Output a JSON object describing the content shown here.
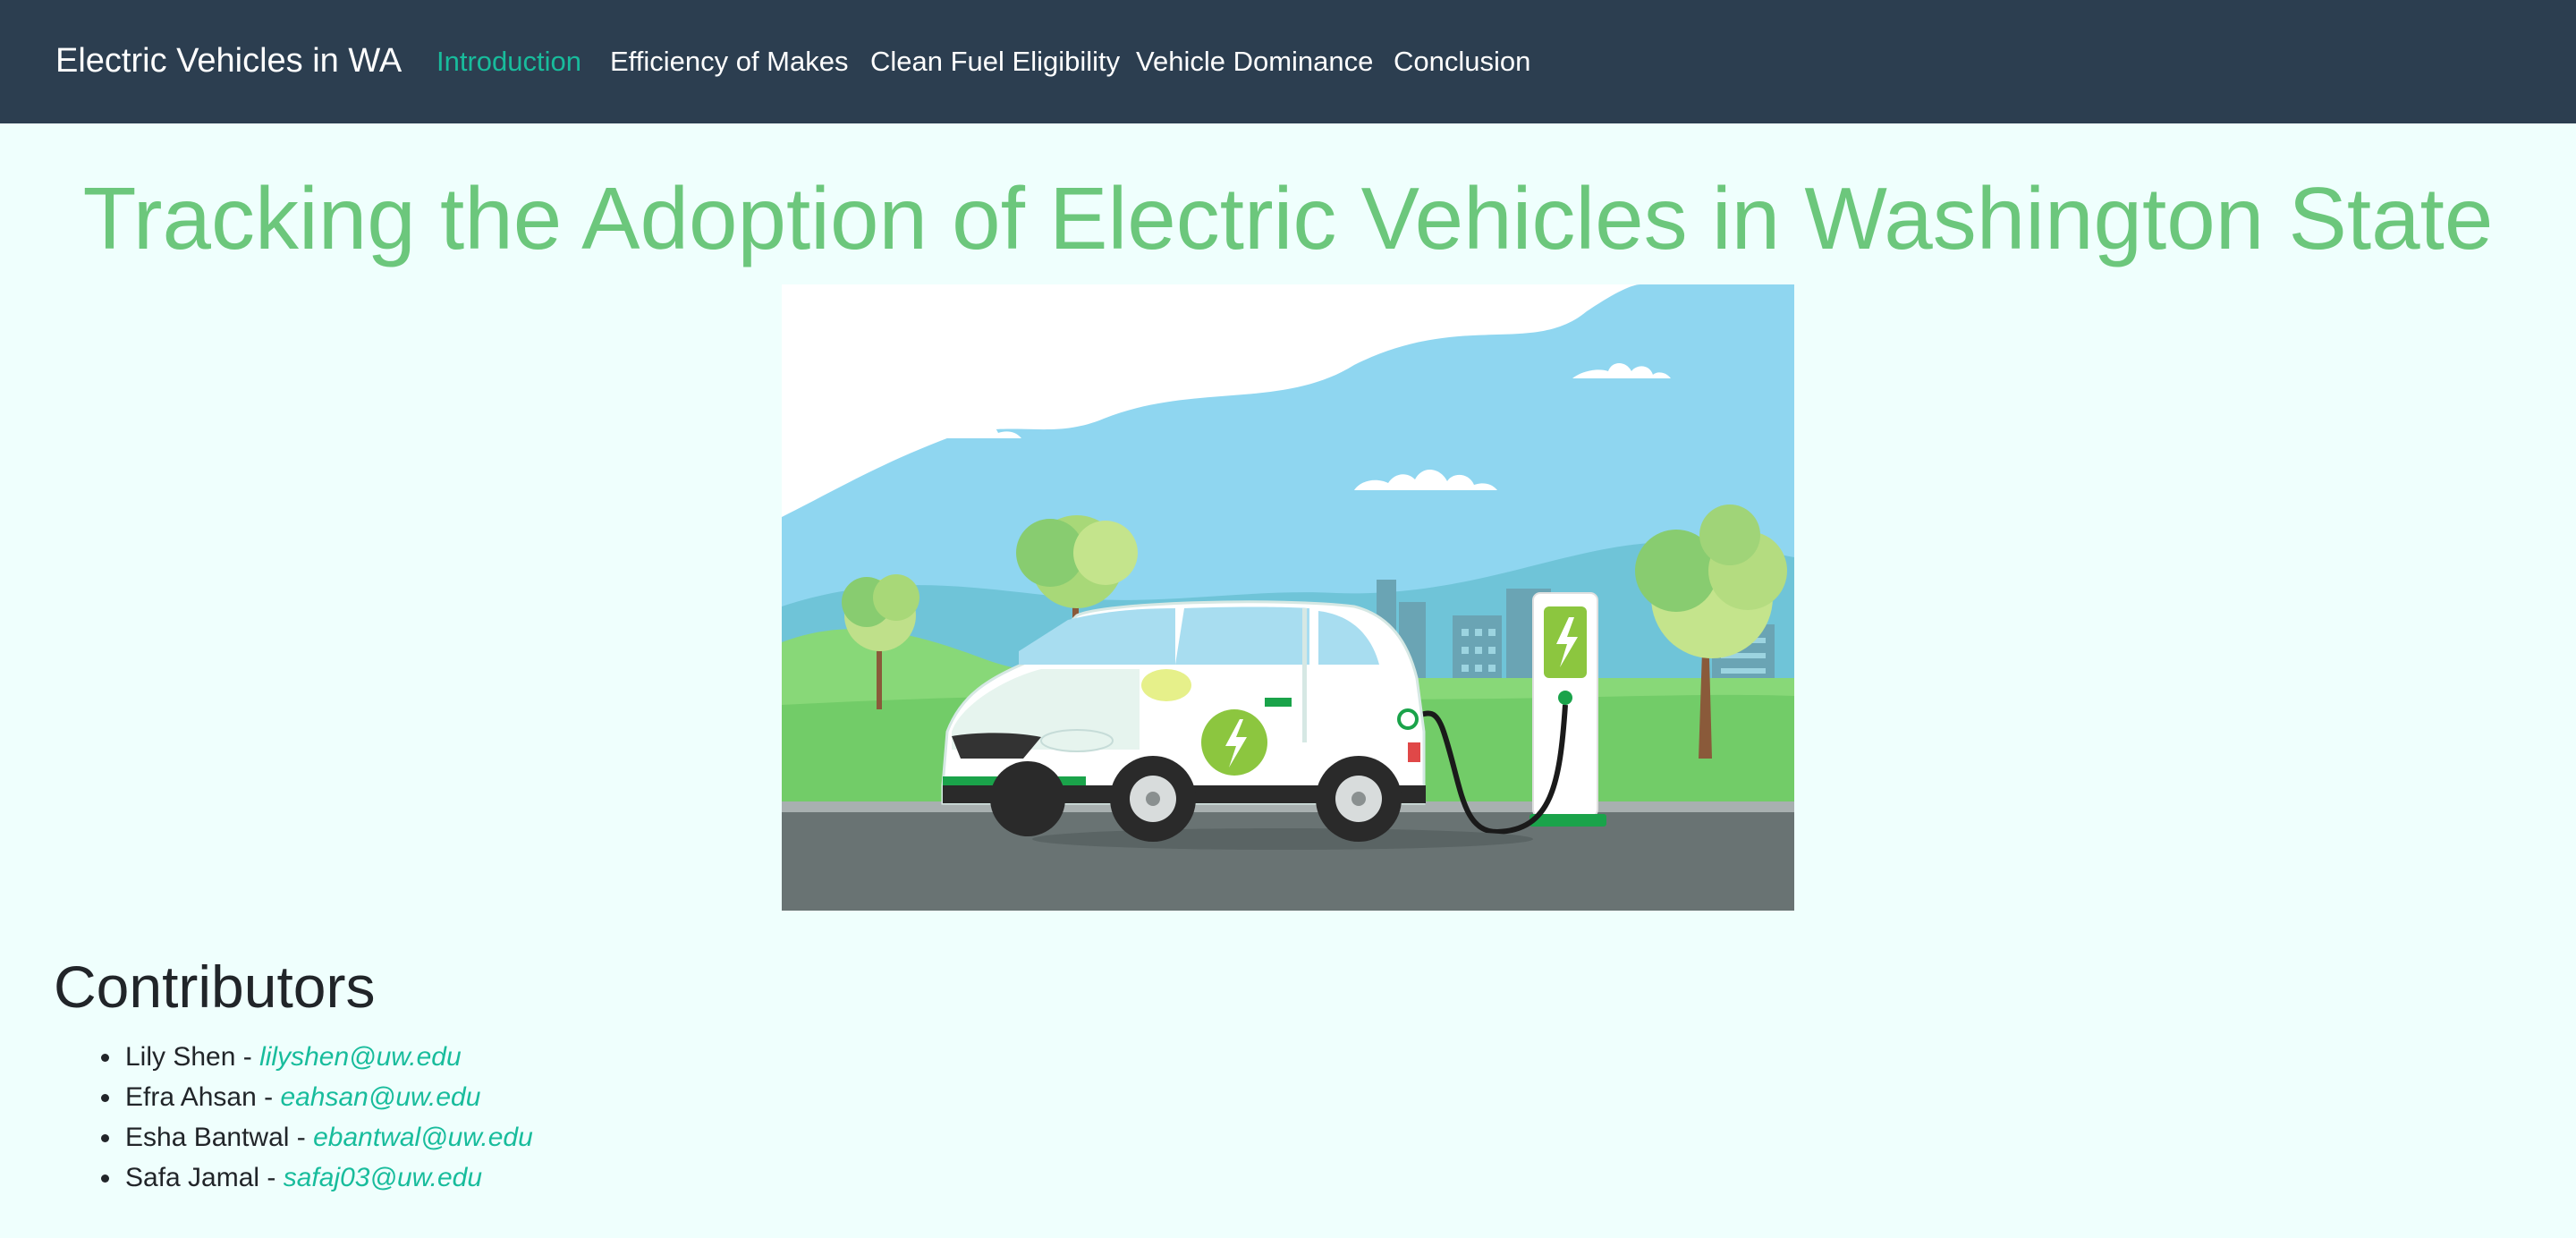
{
  "navbar": {
    "brand": "Electric Vehicles in WA",
    "links": [
      {
        "label": "Introduction",
        "active": true
      },
      {
        "label": "Efficiency of Makes",
        "active": false
      },
      {
        "label": "Clean Fuel Eligibility",
        "active": false
      },
      {
        "label": "Vehicle Dominance",
        "active": false
      },
      {
        "label": "Conclusion",
        "active": false
      }
    ]
  },
  "hero": {
    "title": "Tracking the Adoption of Electric Vehicles in Washington State"
  },
  "contributors": {
    "heading": "Contributors",
    "separator": " - ",
    "people": [
      {
        "name": "Lily Shen",
        "email": "lilyshen@uw.edu"
      },
      {
        "name": "Efra Ahsan",
        "email": "eahsan@uw.edu"
      },
      {
        "name": "Esha Bantwal",
        "email": "ebantwal@uw.edu"
      },
      {
        "name": "Safa Jamal",
        "email": "safaj03@uw.edu"
      }
    ]
  },
  "colors": {
    "navbar_bg": "#2c3e50",
    "page_bg": "#effffd",
    "accent": "#18bc9c",
    "title_green": "#6cc77c"
  },
  "icons": {
    "illustration": "electric-car-charging-illustration"
  }
}
